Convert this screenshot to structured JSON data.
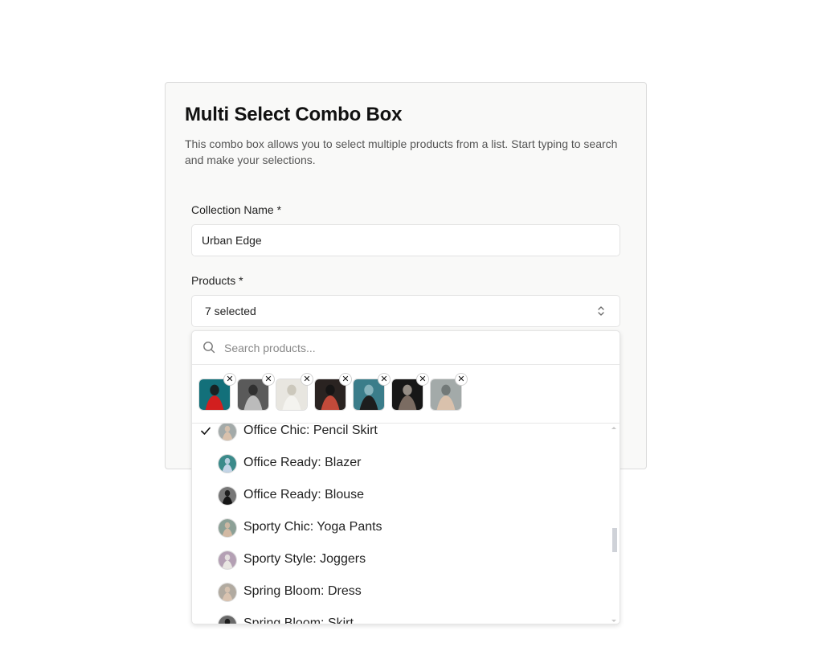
{
  "card": {
    "title": "Multi Select Combo Box",
    "description": "This combo box allows you to select multiple products from a list. Start typing to search and make your selections."
  },
  "form": {
    "collection_label": "Collection Name *",
    "collection_value": "Urban Edge",
    "products_label": "Products *",
    "products_summary": "7 selected"
  },
  "dropdown": {
    "search_placeholder": "Search products...",
    "search_value": "",
    "selected_chips": [
      {
        "name": "selected-product-1",
        "colors": [
          "#13707a",
          "#d21f1f",
          "#1a1a1a"
        ]
      },
      {
        "name": "selected-product-2",
        "colors": [
          "#5a5a5a",
          "#bbbbbb",
          "#2b2b2b"
        ]
      },
      {
        "name": "selected-product-3",
        "colors": [
          "#e8e6e0",
          "#f4f3ef",
          "#c9c4b8"
        ]
      },
      {
        "name": "selected-product-4",
        "colors": [
          "#2a2321",
          "#c24a3a",
          "#141414"
        ]
      },
      {
        "name": "selected-product-5",
        "colors": [
          "#3b7d8a",
          "#1d1d1d",
          "#8fb9c1"
        ]
      },
      {
        "name": "selected-product-6",
        "colors": [
          "#171717",
          "#7b6c62",
          "#a39a91"
        ]
      },
      {
        "name": "selected-product-7",
        "colors": [
          "#a3aaa9",
          "#d9c1ac",
          "#6d7372"
        ]
      }
    ],
    "remove_glyph": "✕",
    "check_glyph": "✓",
    "items": [
      {
        "label": "Office Chic: Pencil Skirt",
        "selected": true,
        "colors": [
          "#a3aaa9",
          "#d9c1ac"
        ]
      },
      {
        "label": "Office Ready: Blazer",
        "selected": false,
        "colors": [
          "#3b8a8a",
          "#c4d4e6"
        ]
      },
      {
        "label": "Office Ready: Blouse",
        "selected": false,
        "colors": [
          "#777777",
          "#151515"
        ]
      },
      {
        "label": "Sporty Chic: Yoga Pants",
        "selected": false,
        "colors": [
          "#8ca096",
          "#d2b9a3"
        ]
      },
      {
        "label": "Sporty Style: Joggers",
        "selected": false,
        "colors": [
          "#b4a0b4",
          "#e9e6e2"
        ]
      },
      {
        "label": "Spring Bloom: Dress",
        "selected": false,
        "colors": [
          "#b1aaa0",
          "#d9c3b0"
        ]
      },
      {
        "label": "Spring Bloom: Skirt",
        "selected": false,
        "colors": [
          "#6a6a6a",
          "#141414"
        ]
      }
    ]
  }
}
